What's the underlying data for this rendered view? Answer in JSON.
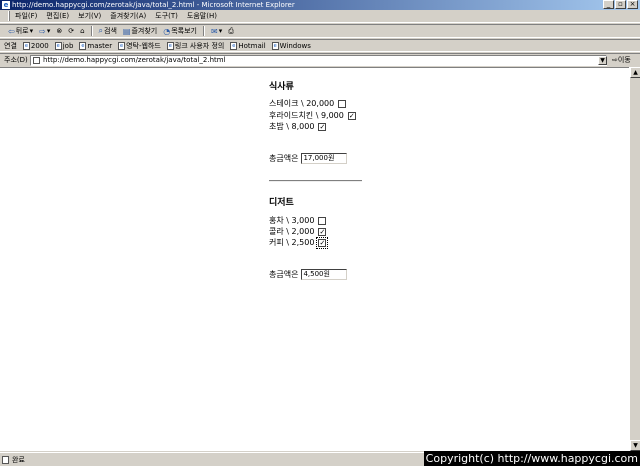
{
  "window": {
    "title": "http://demo.happycgi.com/zerotak/java/total_2.html - Microsoft Internet Explorer",
    "buttons": [
      "_",
      "3",
      "×"
    ]
  },
  "menu": [
    "파일(F)",
    "편집(E)",
    "보기(V)",
    "즐겨찾기(A)",
    "도구(T)",
    "도움말(H)"
  ],
  "toolbar": {
    "back": "뒤로",
    "search": "검색",
    "favorites": "즐겨찾기",
    "history": "목록보기"
  },
  "links": {
    "label": "연결",
    "items": [
      "2000",
      "job",
      "master",
      "영탁-웹하드",
      "링크 사용자 정의",
      "Hotmail",
      "Windows"
    ]
  },
  "address": {
    "label": "주소(D)",
    "url": "http://demo.happycgi.com/zerotak/java/total_2.html",
    "go": "이동"
  },
  "sections": {
    "meal": {
      "title": "식사류",
      "items": [
        {
          "label": "스테이크 \\ 20,000",
          "checked": false
        },
        {
          "label": "후라이드치킨 \\ 9,000",
          "checked": true
        },
        {
          "label": "초밥 \\ 8,000",
          "checked": true
        }
      ],
      "total_label": "총금액은",
      "total_value": "17,000원"
    },
    "dessert": {
      "title": "디저트",
      "items": [
        {
          "label": "홍차 \\ 3,000",
          "checked": false
        },
        {
          "label": "콜라 \\ 2,000",
          "checked": true
        },
        {
          "label": "커피 \\ 2,500",
          "checked": true
        }
      ],
      "total_label": "총금액은",
      "total_value": "4,500원"
    }
  },
  "status": {
    "text": "완료",
    "copyright": "Copyright(c) http://www.happycgi.com"
  }
}
